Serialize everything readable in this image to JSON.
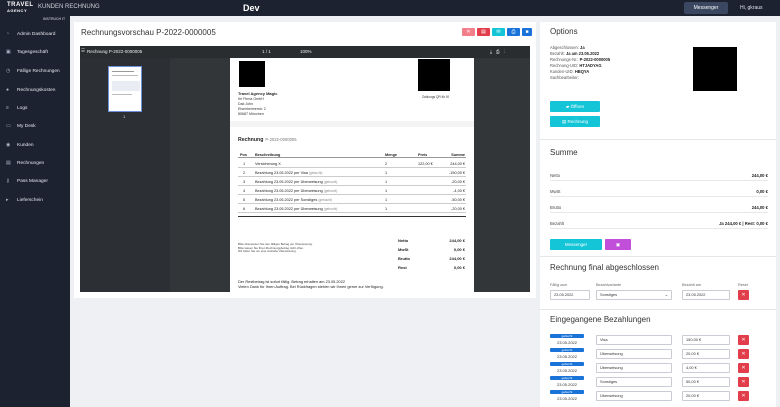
{
  "topbar": {
    "logo_line1": "TRAVEL",
    "logo_line2": "AGENCY",
    "app_title": "KUNDEN RECHNUNG",
    "env": "Dev",
    "messenger_label": "Messenger",
    "greeting": "Hi, gkraus"
  },
  "sidebar": {
    "sub_label": "INSTRUCH IT",
    "items": [
      {
        "label": "Admin Dashboard",
        "icon": "gauge-icon"
      },
      {
        "label": "Tagesgeschäft",
        "icon": "briefcase-icon"
      },
      {
        "label": "Fällige Rechnungen",
        "icon": "clock-icon"
      },
      {
        "label": "Rechnungskosten",
        "icon": "coin-icon"
      },
      {
        "label": "Logs",
        "icon": "list-icon"
      },
      {
        "label": "My Desk",
        "icon": "desk-icon"
      },
      {
        "label": "Kunden",
        "icon": "users-icon"
      },
      {
        "label": "Rechnungen",
        "icon": "invoice-icon"
      },
      {
        "label": "Pass Manager",
        "icon": "key-icon"
      },
      {
        "label": "Lieferschein",
        "icon": "truck-icon"
      }
    ]
  },
  "main": {
    "title": "Rechnungsvorschau P-2022-0000005",
    "viewer": {
      "filename": "Rechnung P-2022-0000005",
      "page": "1 / 1",
      "zoom": "100%",
      "thumb_num": "1"
    },
    "doc": {
      "agency": "Travel Agency Magic",
      "addr": [
        "Ihr Firma GmbH",
        "Dak John",
        "Eisenheimerstr. 2",
        "80687 München"
      ],
      "qr_label": "Zahlungs QR für IK",
      "title": "Rechnung",
      "number": "P-2022-0000005",
      "headers": [
        "Pos",
        "Beschreibung",
        "Menge",
        "Preis",
        "Summe"
      ],
      "rows": [
        {
          "pos": "1",
          "desc": "Versicherung X",
          "tag": "",
          "qty": "2",
          "price": "122,00 €",
          "sum": "244,00 €"
        },
        {
          "pos": "2",
          "desc": "Bezahlung 23.05.2022 per Visa",
          "tag": "(gebucht)",
          "qty": "1",
          "price": "",
          "sum": "-150,00 €"
        },
        {
          "pos": "3",
          "desc": "Bezahlung 23.05.2022 per Überweisung",
          "tag": "(gebucht)",
          "qty": "1",
          "price": "",
          "sum": "-20,00 €"
        },
        {
          "pos": "4",
          "desc": "Bezahlung 23.05.2022 per Überweisung",
          "tag": "(gebucht)",
          "qty": "1",
          "price": "",
          "sum": "-4,00 €"
        },
        {
          "pos": "5",
          "desc": "Bezahlung 23.05.2022 per Sonstiges",
          "tag": "(gebucht)",
          "qty": "1",
          "price": "",
          "sum": "-50,00 €"
        },
        {
          "pos": "6",
          "desc": "Bezahlung 23.05.2022 per Überweisung",
          "tag": "(gebucht)",
          "qty": "1",
          "price": "",
          "sum": "-20,00 €"
        }
      ],
      "notes": [
        "Bitte überweisen Sie den fälligen Betrag per Überweisung.",
        "Bitte lassen Sie Ihren Rechnungsbetrag nicht offen.",
        "Wir bitten Sie um eine zeitnahe Überweisung."
      ],
      "totals": [
        {
          "k": "Netto",
          "v": "244,00 €"
        },
        {
          "k": "MwSt",
          "v": "0,00 €"
        },
        {
          "k": "Brutto",
          "v": "244,00 €"
        },
        {
          "k": "Rest",
          "v": "0,00 €"
        }
      ],
      "due1": "Der Restbetrag ist sofort fällig. Betrag erhalten am 23.05.2022",
      "due2": "Vielen Dank für Ihren Auftrag. Bei Rückfragen stehen wir Ihnen gerne zur Verfügung."
    }
  },
  "options": {
    "title": "Options",
    "lines": [
      {
        "k": "Abgeschlossen:",
        "v": "Ja"
      },
      {
        "k": "Bezahlt:",
        "v": "Ja am 23.05.2022"
      },
      {
        "k": "Rechnungs-Nr.:",
        "v": "P-2022-0000005"
      },
      {
        "k": "Rechnung-UID:",
        "v": "HTJADYAG"
      },
      {
        "k": "Kunden-UID:",
        "v": "HBQYA"
      },
      {
        "k": "Sachbearbeiter:",
        "v": ""
      }
    ],
    "open_label": "Öffnen",
    "invoice_label": "Rechnung"
  },
  "summe": {
    "title": "Summe",
    "lines": [
      {
        "k": "Netto",
        "v": "244,00 €"
      },
      {
        "k": "MwSt",
        "v": "0,00 €"
      },
      {
        "k": "Brutto",
        "v": "244,00 €"
      }
    ],
    "paid_k": "Bezahlt",
    "paid_v": "Ja 244,00 € | Rest: 0,00 €",
    "messenger_label": "Messenger"
  },
  "final": {
    "title": "Rechnung final abgeschlossen",
    "labels": [
      "Fällig zum",
      "Bezahlvariante",
      "Bezahlt am",
      "Reset"
    ],
    "due_date": "23.05.2022",
    "variant": "Sonstiges",
    "paid_date": "23.05.2022"
  },
  "payments": {
    "title": "Eingegangene Bezahlungen",
    "items": [
      {
        "badge": "gebucht",
        "date": "23.05.2022",
        "method": "Visa",
        "amount": "150,00 €"
      },
      {
        "badge": "gebucht",
        "date": "23.05.2022",
        "method": "Überweisung",
        "amount": "20,00 €"
      },
      {
        "badge": "gebucht",
        "date": "23.05.2022",
        "method": "Überweisung",
        "amount": "4,00 €"
      },
      {
        "badge": "gebucht",
        "date": "23.05.2022",
        "method": "Sonstiges",
        "amount": "50,00 €"
      },
      {
        "badge": "gebucht",
        "date": "23.05.2022",
        "method": "Überweisung",
        "amount": "20,00 €"
      }
    ]
  },
  "colors": {
    "sidebar": "#1d2230",
    "accent_cyan": "#14c5d8",
    "accent_purple": "#c24fd9",
    "danger": "#e23d4a",
    "badge_blue": "#1a73d9"
  }
}
